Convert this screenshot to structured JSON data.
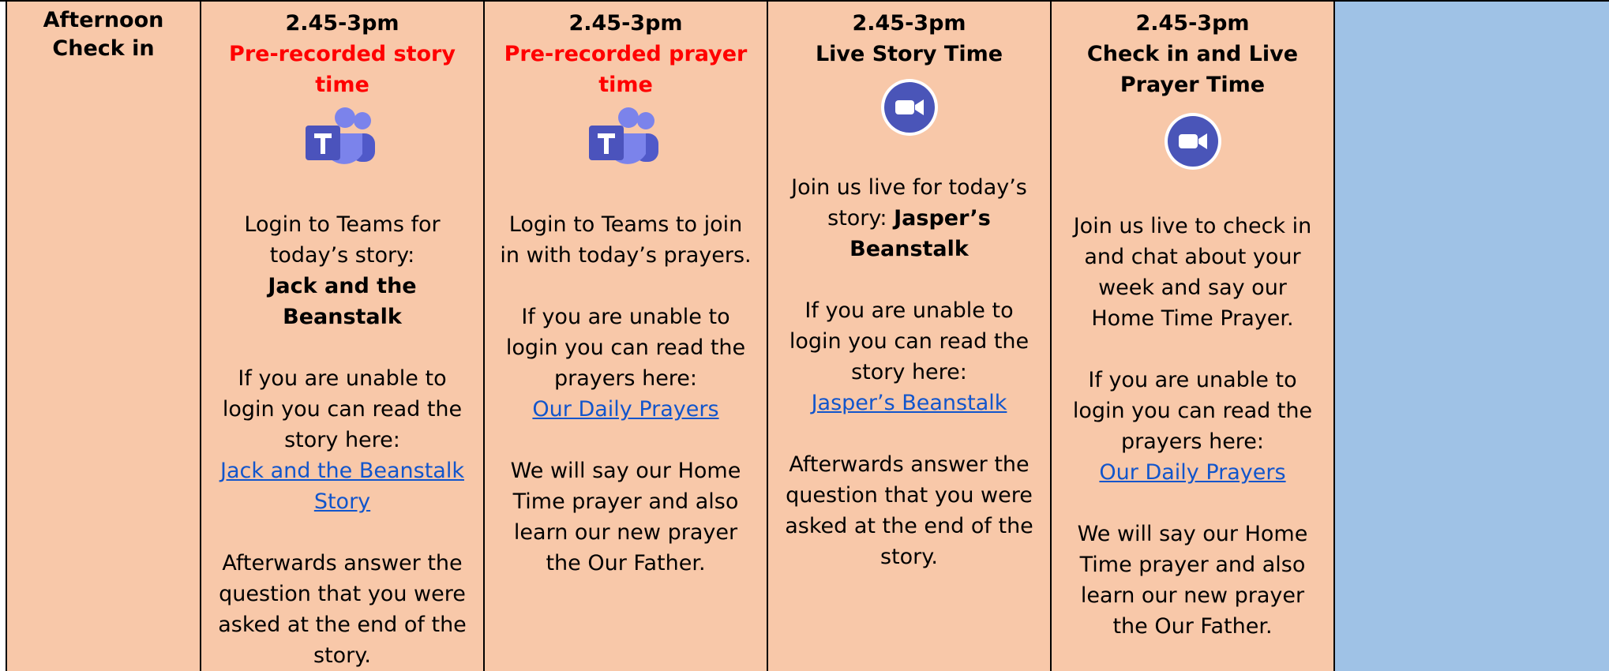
{
  "row": {
    "label": "Afternoon Check in"
  },
  "columns": [
    {
      "time": "2.45-3pm",
      "title": "Pre-recorded story time",
      "icon": "teams-icon",
      "intro_line1": "Login to Teams for today’s story:",
      "intro_bold": "Jack and the Beanstalk",
      "fallback": "If you are unable to login you can read the story here:",
      "link_text": "Jack and the Beanstalk Story",
      "outro": "Afterwards answer the question that you were asked at the end of the story."
    },
    {
      "time": "2.45-3pm",
      "title": "Pre-recorded prayer time",
      "icon": "teams-icon",
      "intro_line1": "Login to Teams to join in with today’s prayers.",
      "fallback": "If you are unable to login you can read the prayers here:",
      "link_text": "Our Daily Prayers",
      "outro": "We will say our Home Time prayer and also learn our new prayer the Our Father."
    },
    {
      "time": "2.45-3pm",
      "title": "Live Story Time",
      "icon": "zoom-icon",
      "intro_line1": "Join us live for today’s story:",
      "intro_bold": "Jasper’s Beanstalk",
      "fallback": "If you are unable to login you can read the story here:",
      "link_text": "Jasper’s Beanstalk",
      "outro": "Afterwards answer the question that you were asked at the end of the story."
    },
    {
      "time": "2.45-3pm",
      "title": "Check in and Live Prayer Time",
      "icon": "zoom-icon",
      "intro_line1": "Join us live to check in and chat about your week and say our Home Time Prayer.",
      "fallback": "If you are unable to login you can read the prayers here:",
      "link_text": "Our Daily Prayers",
      "outro": "We will say our Home Time prayer and also learn our new prayer the Our Father."
    }
  ],
  "colors": {
    "cell_bg": "#f8c8a9",
    "blank_bg": "#9fc2e6",
    "title_red": "#ff0000",
    "link": "#1155cc",
    "teams_purple": "#5b5fc7",
    "zoom_blue": "#4a55b8"
  }
}
